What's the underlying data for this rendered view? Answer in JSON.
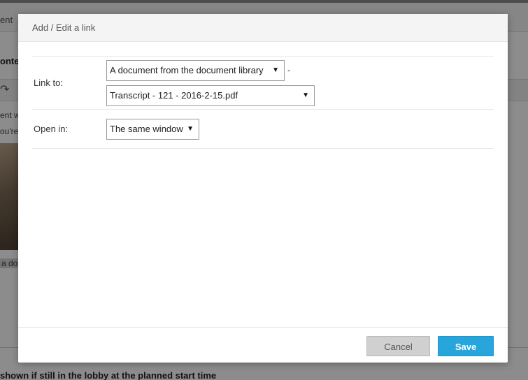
{
  "background": {
    "tab_text": "ent",
    "heading": "onter",
    "line1": "ent w",
    "line2": "ou're",
    "caption": "a do",
    "footer_text": "shown if still in the lobby at the planned start time"
  },
  "dialog": {
    "title": "Add / Edit a link",
    "link_to_label": "Link to:",
    "link_type_value": "A document from the document library",
    "separator": "-",
    "document_value": "Transcript - 121 - 2016-2-15.pdf",
    "open_in_label": "Open in:",
    "open_in_value": "The same window",
    "cancel_label": "Cancel",
    "save_label": "Save"
  },
  "icons": {
    "dropdown": "chevron-down-icon",
    "redo": "redo-icon"
  },
  "colors": {
    "save_button": "#28a6db",
    "cancel_button": "#d0d0d0",
    "overlay": "rgba(0,0,0,0.45)"
  }
}
